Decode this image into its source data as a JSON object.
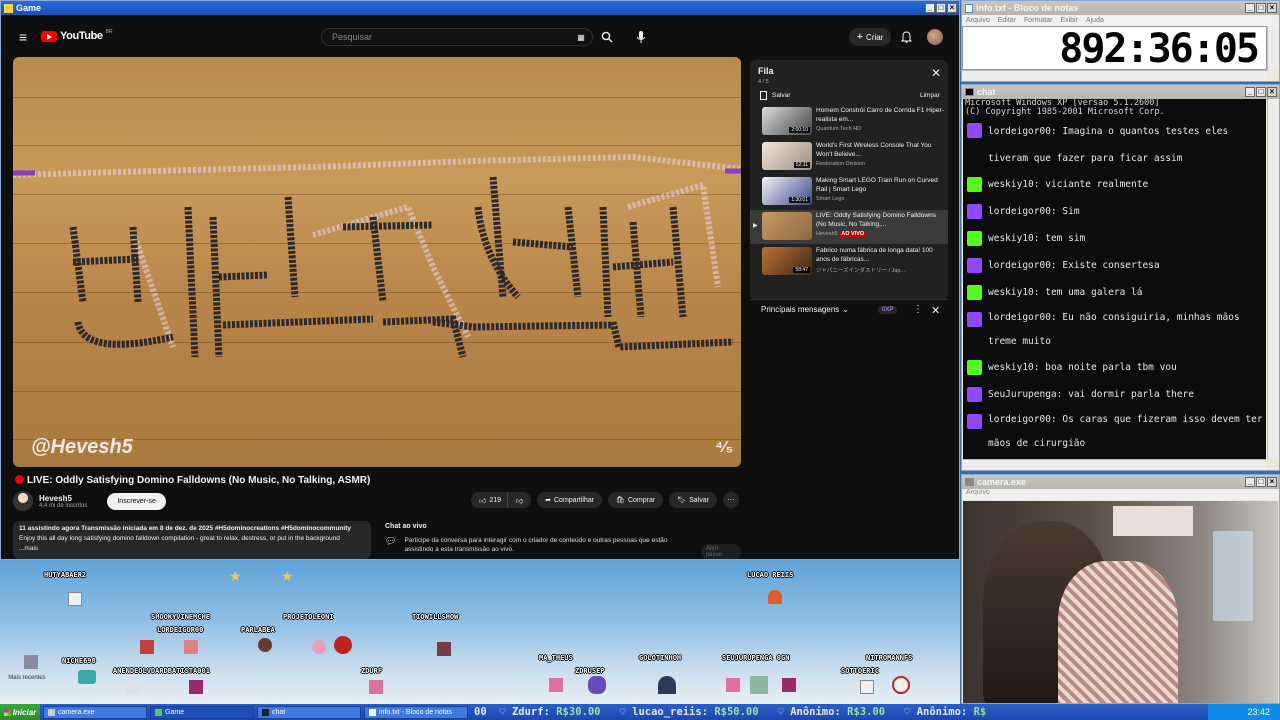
{
  "windows": {
    "game": {
      "title": "Game"
    },
    "notepad": {
      "title": "info.txt - Bloco de notas",
      "menu": [
        "Arquivo",
        "Editar",
        "Formatar",
        "Exibir",
        "Ajuda"
      ],
      "content": "892:36:05"
    },
    "chat": {
      "title": "chat"
    },
    "camera": {
      "title": "camera.exe",
      "menu": "Arquivo"
    }
  },
  "youtube": {
    "logo": "YouTube",
    "region": "BR",
    "search_placeholder": "Pesquisar",
    "create_label": "Criar",
    "video_title": "LIVE: Oddly Satisfying Domino Falldowns (No Music, No Talking, ASMR)",
    "watermark": "@Hevesh5",
    "channel": {
      "name": "Hevesh5",
      "subs": "4,4 mi de inscritos",
      "subscribe_label": "Inscrever-se"
    },
    "actions": {
      "likes": "219",
      "share": "Compartilhar",
      "buy": "Comprar",
      "save": "Salvar"
    },
    "description": {
      "line1": "11 assistindo agora  Transmissão iniciada em 8 de dez. de 2025  #H5dominocreations #H5dominocommunity",
      "line2": "Enjoy this all day long satisfying domino falldown compilation - great to relax, destress, or put in the background",
      "line3": "...mais"
    },
    "chat_preview": {
      "title": "Chat ao vivo",
      "text": "Participe da conversa para interagir com o criador de conteúdo e outras pessoas que estão assistindo a esta transmissão ao vivo.",
      "button": "Abrir painel"
    },
    "queue": {
      "title": "Fila",
      "count": "4 / 5",
      "save": "Salvar",
      "clear": "Limpar",
      "items": [
        {
          "title": "Homem Constrói Carro de Corrida F1 Hiper-realista em...",
          "channel": "Quantum Tech HD",
          "duration": "2:00:10"
        },
        {
          "title": "World's First Wireless Console That You Won't Believe...",
          "channel": "Restoration Division",
          "duration": "52:11"
        },
        {
          "title": "Making Smart LEGO Train Run on Curved Rail | Smart Lego",
          "channel": "Smart Lego",
          "duration": "1:30:01"
        },
        {
          "title": "LIVE: Oddly Satisfying Domino Falldowns (No Music, No Talking,...",
          "channel": "Hevesh5",
          "duration": "AO VIVO"
        },
        {
          "title": "Fabrico numa fábrica de longa data! 100 anos de fábricas...",
          "channel": "ジャパニーズインダストリー / Jap...",
          "duration": "58:47"
        }
      ]
    },
    "top_messages": {
      "label": "Principais mensagens",
      "badge": "0XP"
    }
  },
  "game_strip": {
    "names": [
      "HUTYABAER2",
      "LUCAO REIIS",
      "SHOOKYVINEMCHE",
      "PROJETOLEONI",
      "TIOWILLSHOW",
      "LORDEIGOR00",
      "PARLABEA",
      "NICHE698",
      "ANENDEOLVDARDBATISTA001",
      "ZDURF",
      "MA_THEUS",
      "ZDRUSEP",
      "GOLOTINHOH",
      "SEUJURUPENGA 0GN",
      "NITROMANNFS",
      "SOTTOERIC"
    ],
    "side_text": "Mais recentes"
  },
  "chat": {
    "header": [
      "Microsoft Windows XP [versão 5.1.2600]",
      "(C) Copyright 1985-2001 Microsoft Corp."
    ],
    "messages": [
      {
        "platform": "twitch",
        "user": "lordeigor00",
        "text": "Imagina o quantos testes eles tiveram que fazer para ficar assim"
      },
      {
        "platform": "kick",
        "user": "weskiy10",
        "text": "viciante realmente"
      },
      {
        "platform": "twitch",
        "user": "lordeigor00",
        "text": "Sim"
      },
      {
        "platform": "kick",
        "user": "weskiy10",
        "text": "tem sim"
      },
      {
        "platform": "twitch",
        "user": "lordeigor00",
        "text": "Existe consertesa"
      },
      {
        "platform": "kick",
        "user": "weskiy10",
        "text": "tem uma galera lá"
      },
      {
        "platform": "twitch",
        "user": "lordeigor00",
        "text": "Eu não consiguiria, minhas mãos treme muito"
      },
      {
        "platform": "kick",
        "user": "weskiy10",
        "text": "boa noite parla tbm vou"
      },
      {
        "platform": "twitch",
        "user": "SeuJurupenga",
        "text": "vai dormir parla there"
      },
      {
        "platform": "twitch",
        "user": "lordeigor00",
        "text": "Os caras que fizeram isso devem ter mãos de cirurgião"
      }
    ]
  },
  "taskbar": {
    "start": "Iniciar",
    "buttons": [
      "camera.exe",
      "Game",
      "chat",
      "info.txt - Bloco de notas"
    ],
    "ticker": [
      {
        "lead": "00"
      },
      {
        "name": "Zdurf:",
        "amount": "R$30.00"
      },
      {
        "name": "lucao_reiis:",
        "amount": "R$50.00"
      },
      {
        "name": "Anônimo:",
        "amount": "R$3.00"
      },
      {
        "name": "Anônimo:",
        "amount": "R$"
      }
    ],
    "clock": "23:42"
  },
  "colors": {
    "yt_bg": "#0f0f0f",
    "xp_blue": "#1450b8",
    "twitch": "#9146ff",
    "kick": "#53fc18",
    "live_red": "#ff0000"
  }
}
